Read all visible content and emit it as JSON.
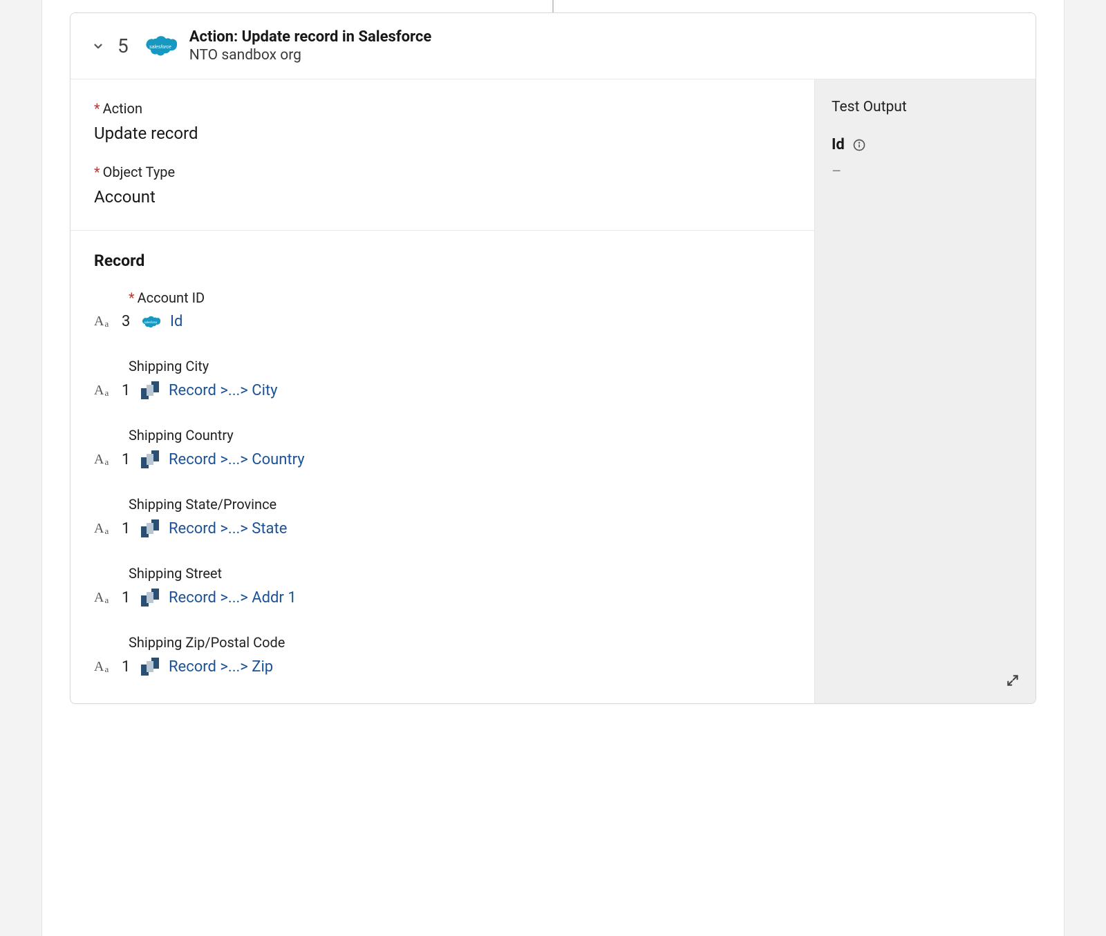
{
  "step": {
    "number": "5",
    "title": "Action: Update record in Salesforce",
    "subtitle": "NTO sandbox org"
  },
  "top": {
    "action": {
      "label": "Action",
      "value": "Update record"
    },
    "objectType": {
      "label": "Object Type",
      "value": "Account"
    }
  },
  "record": {
    "title": "Record",
    "fields": [
      {
        "label": "Account ID",
        "required": true,
        "step": "3",
        "icon": "salesforce",
        "path": "Id"
      },
      {
        "label": "Shipping City",
        "required": false,
        "step": "1",
        "icon": "netsuite",
        "path": "Record >...> City"
      },
      {
        "label": "Shipping Country",
        "required": false,
        "step": "1",
        "icon": "netsuite",
        "path": "Record >...> Country"
      },
      {
        "label": "Shipping State/Province",
        "required": false,
        "step": "1",
        "icon": "netsuite",
        "path": "Record >...> State"
      },
      {
        "label": "Shipping Street",
        "required": false,
        "step": "1",
        "icon": "netsuite",
        "path": "Record >...> Addr 1"
      },
      {
        "label": "Shipping Zip/Postal Code",
        "required": false,
        "step": "1",
        "icon": "netsuite",
        "path": "Record >...> Zip"
      }
    ]
  },
  "sidebar": {
    "title": "Test Output",
    "idLabel": "Id",
    "idValue": "–"
  }
}
